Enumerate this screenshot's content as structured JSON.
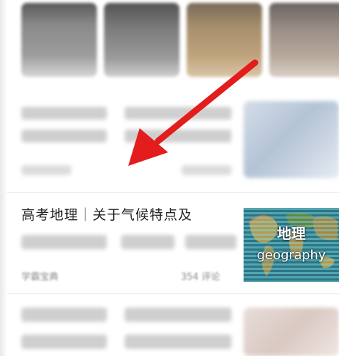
{
  "article": {
    "title": "高考地理｜关于气候特点及",
    "source": "学霸宝典",
    "comments": "354 评论",
    "thumbnail": {
      "title": "地理",
      "subtitle": "geography"
    }
  },
  "colors": {
    "arrow": "#e31d1d",
    "title_text": "#222222",
    "meta_text": "#8a8a8a"
  },
  "icons": [
    "red-arrow-icon"
  ]
}
